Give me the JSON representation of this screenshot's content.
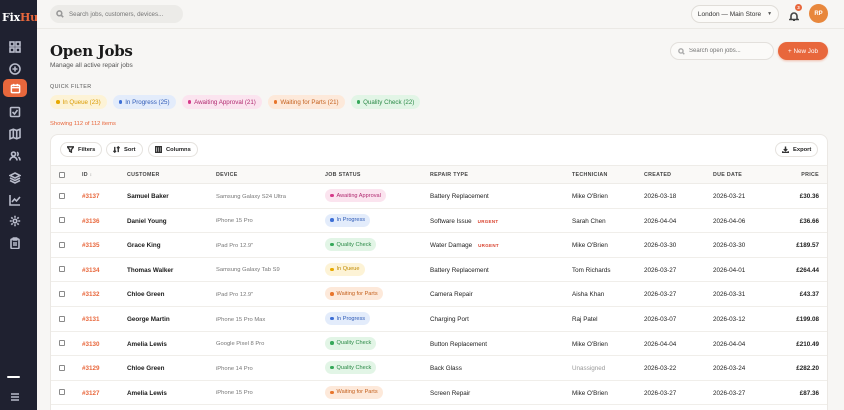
{
  "brand": {
    "name_a": "Fix",
    "name_b": "Hub"
  },
  "topbar": {
    "search_placeholder": "Search jobs, customers, devices...",
    "store": "London — Main Store",
    "notification_count": "3",
    "avatar_initials": "RP"
  },
  "header": {
    "title": "Open Jobs",
    "subtitle": "Manage all active repair jobs",
    "search_placeholder": "Search open jobs...",
    "new_job_label": "+ New Job"
  },
  "quick_filter": {
    "label": "QUICK FILTER",
    "chips": [
      {
        "label": "In Queue (23)",
        "color": "#d99a00",
        "bg": "#fdf3d6",
        "dot": "#e7a900"
      },
      {
        "label": "In Progress (25)",
        "color": "#2f5bb7",
        "bg": "#e3ecfb",
        "dot": "#3d6fd6"
      },
      {
        "label": "Awaiting Approval (21)",
        "color": "#b02a70",
        "bg": "#fbe4ef",
        "dot": "#d63a8a"
      },
      {
        "label": "Waiting for Parts (21)",
        "color": "#c4601d",
        "bg": "#fde9da",
        "dot": "#e8752c"
      },
      {
        "label": "Quality Check (22)",
        "color": "#2b8a47",
        "bg": "#e2f5e6",
        "dot": "#36a85a"
      }
    ]
  },
  "showing": "Showing 112 of 112 items",
  "toolbar": {
    "filters": "Filters",
    "sort": "Sort",
    "columns": "Columns",
    "export": "Export"
  },
  "columns": [
    "ID",
    "CUSTOMER",
    "DEVICE",
    "JOB STATUS",
    "REPAIR TYPE",
    "TECHNICIAN",
    "CREATED",
    "DUE DATE",
    "PRICE"
  ],
  "rows": [
    {
      "id": "#3137",
      "customer": "Samuel Baker",
      "device": "Samsung Galaxy S24 Ultra",
      "status": "Awaiting Approval",
      "status_key": "awaiting",
      "repair": "Battery Replacement",
      "urgent": "",
      "tech": "Mike O'Brien",
      "created": "2026-03-18",
      "due": "2026-03-21",
      "price": "£30.36"
    },
    {
      "id": "#3136",
      "customer": "Daniel Young",
      "device": "iPhone 15 Pro",
      "status": "In Progress",
      "status_key": "progress",
      "repair": "Software Issue",
      "urgent": "URGENT",
      "tech": "Sarah Chen",
      "created": "2026-04-04",
      "due": "2026-04-06",
      "price": "£36.66"
    },
    {
      "id": "#3135",
      "customer": "Grace King",
      "device": "iPad Pro 12.9\"",
      "status": "Quality Check",
      "status_key": "quality",
      "repair": "Water Damage",
      "urgent": "URGENT",
      "tech": "Mike O'Brien",
      "created": "2026-03-30",
      "due": "2026-03-30",
      "price": "£189.57"
    },
    {
      "id": "#3134",
      "customer": "Thomas Walker",
      "device": "Samsung Galaxy Tab S9",
      "status": "In Queue",
      "status_key": "queue",
      "repair": "Battery Replacement",
      "urgent": "",
      "tech": "Tom Richards",
      "created": "2026-03-27",
      "due": "2026-04-01",
      "price": "£264.44"
    },
    {
      "id": "#3132",
      "customer": "Chloe Green",
      "device": "iPad Pro 12.9\"",
      "status": "Waiting for Parts",
      "status_key": "parts",
      "repair": "Camera Repair",
      "urgent": "",
      "tech": "Aisha Khan",
      "created": "2026-03-27",
      "due": "2026-03-31",
      "price": "£43.37"
    },
    {
      "id": "#3131",
      "customer": "George Martin",
      "device": "iPhone 15 Pro Max",
      "status": "In Progress",
      "status_key": "progress",
      "repair": "Charging Port",
      "urgent": "",
      "tech": "Raj Patel",
      "created": "2026-03-07",
      "due": "2026-03-12",
      "price": "£199.08"
    },
    {
      "id": "#3130",
      "customer": "Amelia Lewis",
      "device": "Google Pixel 8 Pro",
      "status": "Quality Check",
      "status_key": "quality",
      "repair": "Button Replacement",
      "urgent": "",
      "tech": "Mike O'Brien",
      "created": "2026-04-04",
      "due": "2026-04-04",
      "price": "£210.49"
    },
    {
      "id": "#3129",
      "customer": "Chloe Green",
      "device": "iPhone 14 Pro",
      "status": "Quality Check",
      "status_key": "quality",
      "repair": "Back Glass",
      "urgent": "",
      "tech": "Unassigned",
      "created": "2026-03-22",
      "due": "2026-03-24",
      "price": "£282.20"
    },
    {
      "id": "#3127",
      "customer": "Amelia Lewis",
      "device": "iPhone 15 Pro",
      "status": "Waiting for Parts",
      "status_key": "parts",
      "repair": "Screen Repair",
      "urgent": "",
      "tech": "Mike O'Brien",
      "created": "2026-03-27",
      "due": "2026-03-27",
      "price": "£87.36"
    }
  ],
  "status_styles": {
    "awaiting": {
      "color": "#b02a70",
      "bg": "#fbe4ef",
      "dot": "#d63a8a"
    },
    "progress": {
      "color": "#2f5bb7",
      "bg": "#e3ecfb",
      "dot": "#3d6fd6"
    },
    "quality": {
      "color": "#2b8a47",
      "bg": "#e2f5e6",
      "dot": "#36a85a"
    },
    "queue": {
      "color": "#c08a00",
      "bg": "#fdf3d6",
      "dot": "#e7a900"
    },
    "parts": {
      "color": "#c4601d",
      "bg": "#fde9da",
      "dot": "#e8752c"
    }
  }
}
